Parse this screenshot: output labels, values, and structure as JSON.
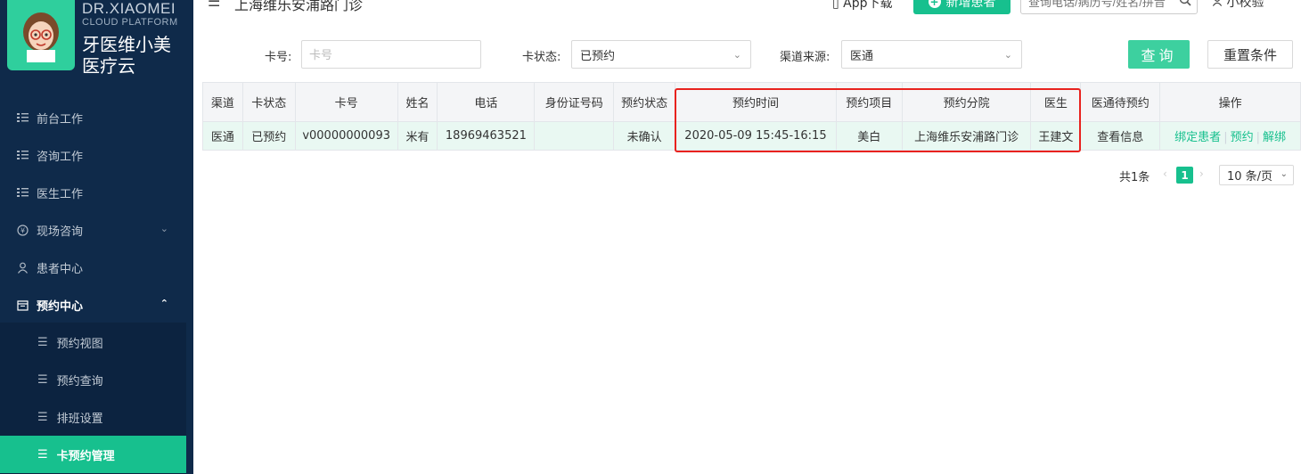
{
  "brand": {
    "en_line1": "DR.XIAOMEI",
    "en_line2": "CLOUD PLATFORM",
    "cn_line1": "牙医维小美",
    "cn_line2": "医疗云"
  },
  "header": {
    "menu_toggle": "☰",
    "store_name": "上海维乐安浦路门诊",
    "app_download": "App下载",
    "new_patient": "新增患者",
    "search_placeholder": "查询电话/病历号/姓名/拼音",
    "user_name": "小校验"
  },
  "sidebar": {
    "items": [
      {
        "label": "前台工作",
        "icon": "list-icon"
      },
      {
        "label": "咨询工作",
        "icon": "list-icon"
      },
      {
        "label": "医生工作",
        "icon": "list-icon"
      },
      {
        "label": "现场咨询",
        "icon": "coin-icon"
      },
      {
        "label": "患者中心",
        "icon": "user-icon"
      },
      {
        "label": "预约中心",
        "icon": "calendar-icon"
      }
    ],
    "sub_items": [
      {
        "label": "预约视图"
      },
      {
        "label": "预约查询"
      },
      {
        "label": "排班设置"
      },
      {
        "label": "卡预约管理"
      }
    ]
  },
  "filters": {
    "card_no_label": "卡号:",
    "card_no_placeholder": "卡号",
    "card_status_label": "卡状态:",
    "card_status_value": "已预约",
    "channel_label": "渠道来源:",
    "channel_value": "医通",
    "query_button": "查询",
    "reset_button": "重置条件"
  },
  "table": {
    "columns": [
      "渠道",
      "卡状态",
      "卡号",
      "姓名",
      "电话",
      "身份证号码",
      "预约状态",
      "预约时间",
      "预约项目",
      "预约分院",
      "医生",
      "医通待预约",
      "操作"
    ],
    "rows": [
      {
        "channel": "医通",
        "card_status": "已预约",
        "card_no": "v00000000093",
        "name": "米有",
        "phone": "18969463521",
        "id_no": "",
        "appt_status": "未确认",
        "appt_time": "2020-05-09 15:45-16:15",
        "appt_item": "美白",
        "branch": "上海维乐安浦路门诊",
        "doctor": "王建文",
        "pending_link": "查看信息",
        "ops": [
          "绑定患者",
          "预约",
          "解绑"
        ]
      }
    ]
  },
  "pagination": {
    "total": "共1条",
    "current_page": "1",
    "page_size": "10 条/页"
  },
  "colors": {
    "accent": "#17c08e",
    "sidebar_bg": "#0f2a4a",
    "highlight": "#e8221e"
  }
}
